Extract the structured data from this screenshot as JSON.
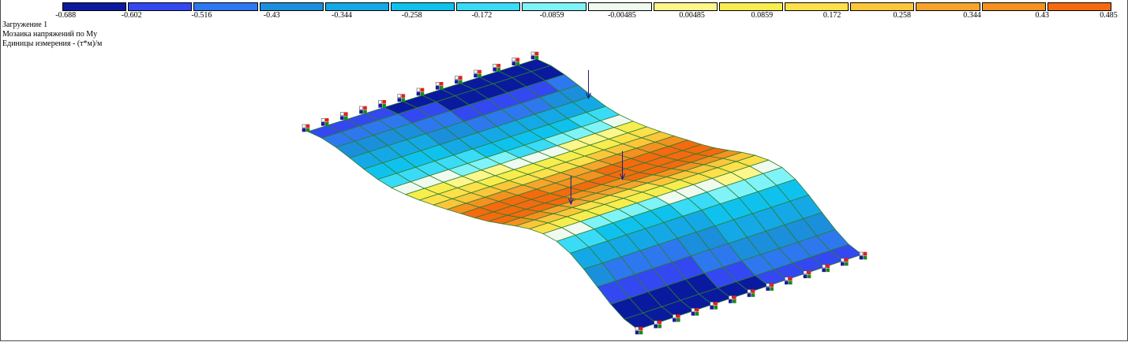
{
  "legend": {
    "ticks": [
      "-0.688",
      "-0.602",
      "-0.516",
      "-0.43",
      "-0.344",
      "-0.258",
      "-0.172",
      "-0.0859",
      "-0.00485",
      "0.00485",
      "0.0859",
      "0.172",
      "0.258",
      "0.344",
      "0.43",
      "0.485"
    ],
    "colors": [
      "#0a1a9e",
      "#3348f0",
      "#2e78ef",
      "#1b8fdc",
      "#14a9e6",
      "#0fc2ee",
      "#3adbf7",
      "#7ff3f7",
      "#eefbee",
      "#fdf68a",
      "#f7ed4e",
      "#fde04a",
      "#fbc63a",
      "#f6a42c",
      "#f4911f",
      "#f56a0e"
    ]
  },
  "info": {
    "load_case": "Загружение 1",
    "mosaic_title": "Мозаика напряжений по My",
    "units": "Единицы измерения - (т*м)/м"
  },
  "icons": {
    "support": "support-node-icon",
    "load_arrow": "load-arrow-icon"
  }
}
